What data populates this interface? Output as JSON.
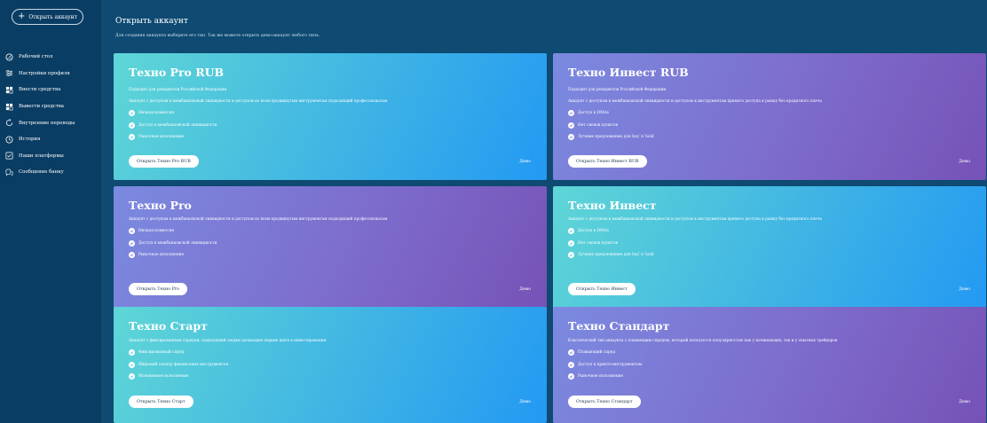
{
  "sidebar": {
    "open_account_label": "Открыть аккаунт",
    "items": [
      {
        "label": "Рабочий стол",
        "icon": "dashboard-icon"
      },
      {
        "label": "Настройки профиля",
        "icon": "settings-sliders-icon"
      },
      {
        "label": "Внести средства",
        "icon": "deposit-icon"
      },
      {
        "label": "Вывести средства",
        "icon": "withdraw-icon"
      },
      {
        "label": "Внутренние переводы",
        "icon": "transfer-icon"
      },
      {
        "label": "История",
        "icon": "clock-icon"
      },
      {
        "label": "Наши платформы",
        "icon": "platforms-icon"
      },
      {
        "label": "Сообщение банку",
        "icon": "message-icon"
      }
    ]
  },
  "main": {
    "title": "Открыть аккаунт",
    "subtitle": "Для создания аккаунта выберите его тип. Так же можете открыть демо-аккаунт любого типа."
  },
  "cards": [
    {
      "title": "Техно Pro RUB",
      "sub": "Подходит для резидентов Российской Федерации",
      "desc": "Аккаунт с доступом к межбанковской ликвидности и доступом ко всем продвинутым инструментам подходящий профессионалам",
      "features": [
        "Низкая комиссия",
        "Доступ к межбанковской ликвидности",
        "Рыночное исполнение"
      ],
      "button": "Открыть Техно Pro RUB",
      "demo": "Демо"
    },
    {
      "title": "Техно Инвест RUB",
      "sub": "Подходит для резидентов Российской Федерации",
      "desc": "Аккаунт с доступом к межбанковской ликвидности и доступом к инструментам прямого доступа к рынку без кредитного плеча",
      "features": [
        "Доступ к DMAs",
        "Нет свопов пунктов",
        "Лучшее предложение для buy`n`hold"
      ],
      "button": "Открыть Техно Инвест RUB",
      "demo": "Демо"
    },
    {
      "title": "Техно Pro",
      "sub": "",
      "desc": "Аккаунт с доступом к межбанковской ликвидности и доступом ко всем продвинутым инструментам подходящий профессионалам",
      "features": [
        "Низкая комиссия",
        "Доступ к межбанковской ликвидности",
        "Рыночное исполнение"
      ],
      "button": "Открыть Техно Pro",
      "demo": "Демо"
    },
    {
      "title": "Техно Инвест",
      "sub": "",
      "desc": "Аккаунт с доступом к межбанковской ликвидности и доступом к инструментам прямого доступа к рынку без кредитного плеча",
      "features": [
        "Доступ к DMAs",
        "Нет свопов пунктов",
        "Лучшее предложение для buy`n`hold"
      ],
      "button": "Открыть Техно Инвест",
      "demo": "Демо"
    },
    {
      "title": "Техно Старт",
      "sub": "",
      "desc": "Аккаунт с фиксированным спредом, подходящий людям делающим первые шаги в инвестировании",
      "features": [
        "Фиксированный спред",
        "Широкий спектр финансовых инструментов",
        "Мгновенное исполнение"
      ],
      "button": "Открыть Техно Старт",
      "demo": "Демо"
    },
    {
      "title": "Техно Стандарт",
      "sub": "",
      "desc": "Классический тип аккаунта с плавающим спредом, который пользуется популярностью как у начинающих, так и у опытных трейдеров",
      "features": [
        "Плавающий спред",
        "Доступ к крипто-инструментам",
        "Рыночное исполнение"
      ],
      "button": "Открыть Техно Стандарт",
      "demo": "Демо"
    }
  ]
}
